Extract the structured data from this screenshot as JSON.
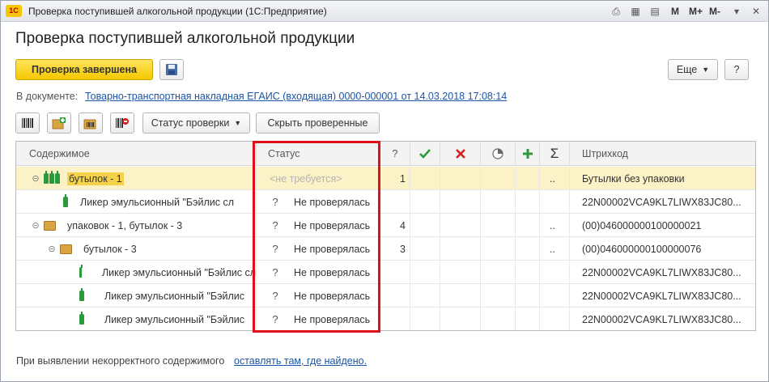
{
  "window": {
    "title": "Проверка поступившей алкогольной продукции  (1С:Предприятие)",
    "logo": "1С",
    "titlebar_icons": [
      "print-icon",
      "calculator-icon",
      "calendar-icon"
    ],
    "memory_labels": [
      "M",
      "M+",
      "M-"
    ]
  },
  "form": {
    "title": "Проверка поступившей алкогольной продукции",
    "finish_button": "Проверка завершена",
    "more_button": "Еще",
    "help_button": "?",
    "document_label": "В документе:",
    "document_link": "Товарно-транспортная накладная ЕГАИС (входящая) 0000-000001 от 14.03.2018 17:08:14",
    "status_menu": "Статус проверки",
    "hide_checked": "Скрыть проверенные"
  },
  "table": {
    "headers": {
      "content": "Содержимое",
      "status": "Статус",
      "q": "?",
      "sum": "Σ",
      "barcode": "Штрихкод"
    },
    "rows": [
      {
        "content": "бутылок -  1",
        "status": "<не требуется>",
        "q": "",
        "count": "1",
        "dots": "..",
        "barcode": "Бутылки без упаковки"
      },
      {
        "content": "Ликер эмульсионный \"Бэйлис сл",
        "status": "Не проверялась",
        "q": "?",
        "count": "",
        "dots": "",
        "barcode": "22N00002VCA9KL7LIWX83JC80..."
      },
      {
        "content": "упаковок - 1, бутылок -  3",
        "status": "Не проверялась",
        "q": "?",
        "count": "4",
        "dots": "..",
        "barcode": "(00)046000000100000021"
      },
      {
        "content": "бутылок -  3",
        "status": "Не проверялась",
        "q": "?",
        "count": "3",
        "dots": "..",
        "barcode": "(00)046000000100000076"
      },
      {
        "content": "Ликер эмульсионный \"Бэйлис сл",
        "status": "Не проверялась",
        "q": "?",
        "count": "",
        "dots": "",
        "barcode": "22N00002VCA9KL7LIWX83JC80..."
      },
      {
        "content": "Ликер эмульсионный \"Бэйлис",
        "status": "Не проверялась",
        "q": "?",
        "count": "",
        "dots": "",
        "barcode": "22N00002VCA9KL7LIWX83JC80..."
      },
      {
        "content": "Ликер эмульсионный \"Бэйлис",
        "status": "Не проверялась",
        "q": "?",
        "count": "",
        "dots": "",
        "barcode": "22N00002VCA9KL7LIWX83JC80..."
      }
    ]
  },
  "footer": {
    "label": "При выявлении некорректного содержимого",
    "link": "оставлять там, где найдено."
  },
  "colors": {
    "accent_yellow": "#f5c800",
    "selected_row": "#fbf2c7",
    "highlight_frame": "#e0101a",
    "link": "#1a55a8"
  }
}
